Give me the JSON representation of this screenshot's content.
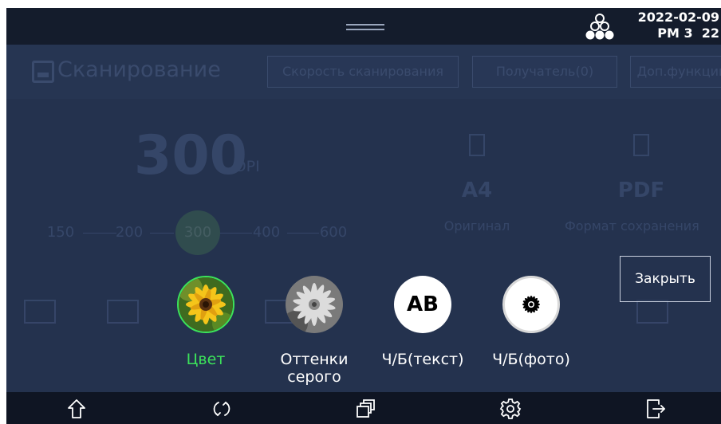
{
  "status": {
    "date": "2022-02-09",
    "time": "PM 3  22"
  },
  "background": {
    "title": "Сканирование",
    "buttons": [
      "Скорость сканирования",
      "Получатель(0)",
      "Доп.функции"
    ],
    "dpi_value": "300",
    "dpi_unit": "DPI",
    "resolution_options": [
      "150",
      "200",
      "300",
      "400",
      "600"
    ],
    "selected_resolution": "300",
    "original_size": "A4",
    "original_label": "Оригинал",
    "save_format": "PDF",
    "save_format_label": "Формат сохранения"
  },
  "close_button": "Закрыть",
  "color_modes": {
    "items": [
      {
        "label": "Цвет",
        "icon": "color-flower-photo",
        "selected": true
      },
      {
        "label": "Оттенки\nсерого",
        "icon": "grayscale-flower-photo",
        "selected": false
      },
      {
        "label": "Ч/Б(текст)",
        "icon": "ab-text-icon",
        "circle_text": "AB",
        "selected": false
      },
      {
        "label": "Ч/Б(фото)",
        "icon": "black-flower-icon",
        "selected": false
      }
    ],
    "selected_color": "#3ce35a"
  },
  "navbar": {
    "icons": [
      "home-icon",
      "refresh-icon",
      "copy-windows-icon",
      "settings-icon",
      "logout-icon"
    ]
  },
  "colors": {
    "screen_bg": "#24324e",
    "statusbar_bg": "#141c2c",
    "navbar_bg": "#0f1523"
  }
}
